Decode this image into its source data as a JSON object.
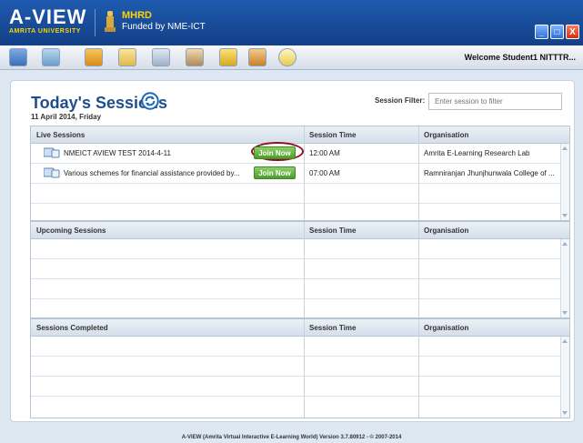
{
  "app": {
    "logo_title": "A-VIEW",
    "logo_subtitle": "AMRITA UNIVERSITY",
    "mhrd": "MHRD",
    "funded_by": "Funded by NME-ICT",
    "window_buttons": [
      "_",
      "□",
      "X"
    ]
  },
  "toolbar": {
    "tools": [
      "users-icon",
      "group-icon",
      "book-icon",
      "help-icon",
      "video-icon",
      "profile-icon",
      "edit-icon",
      "briefcase-icon",
      "info-icon"
    ],
    "welcome": "Welcome Student1 NITTTR..."
  },
  "page": {
    "title": "Today's Sessions",
    "date": "11 April 2014, Friday",
    "filter_label": "Session Filter:",
    "filter_placeholder": "Enter session to filter"
  },
  "live": {
    "headers": [
      "Live Sessions",
      "Session Time",
      "Organisation"
    ],
    "rows": [
      {
        "name": "NMEICT AVIEW TEST 2014-4-11",
        "button": "Join Now",
        "time": "12:00 AM",
        "org": "Amrita E-Learning Research Lab"
      },
      {
        "name": "Various schemes for financial assistance provided by...",
        "button": "Join Now",
        "time": "07:00 AM",
        "org": "Ramniranjan Jhunjhunwala College of ..."
      }
    ]
  },
  "upcoming": {
    "headers": [
      "Upcoming Sessions",
      "Session Time",
      "Organisation"
    ]
  },
  "completed": {
    "headers": [
      "Sessions Completed",
      "Session Time",
      "Organisation"
    ]
  },
  "footer": "A-VIEW (Amrita Virtual Interactive E-Learning World) Version 3.7.80912 - © 2007-2014",
  "colors": {
    "accent": "#1f4e8e",
    "join_button": "#5aae34",
    "highlight": "#8b1020"
  }
}
